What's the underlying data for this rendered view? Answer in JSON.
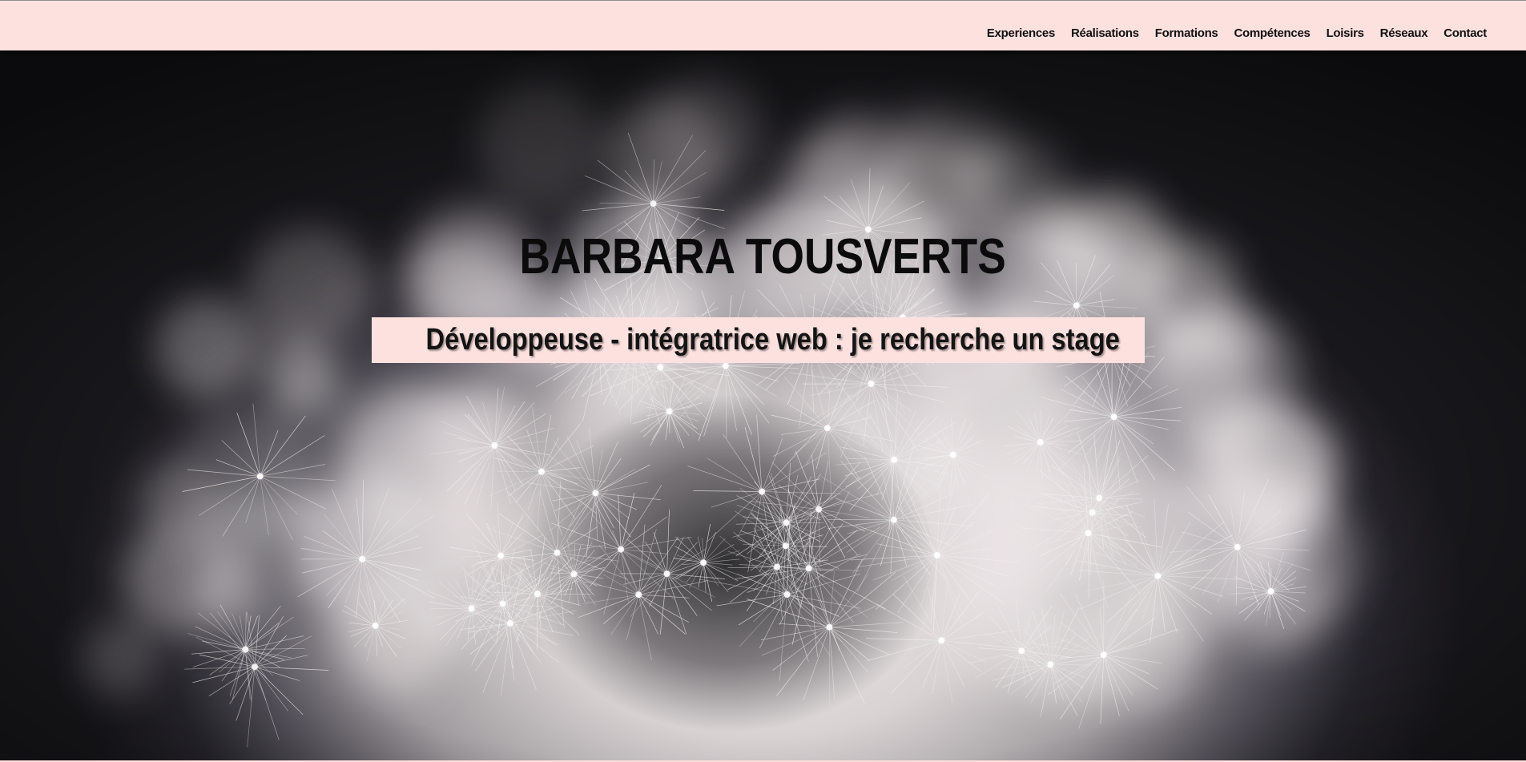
{
  "nav": {
    "items": [
      {
        "label": "Experiences"
      },
      {
        "label": "Réalisations"
      },
      {
        "label": "Formations"
      },
      {
        "label": "Compétences"
      },
      {
        "label": "Loisirs"
      },
      {
        "label": "Réseaux"
      },
      {
        "label": "Contact"
      }
    ]
  },
  "hero": {
    "title": "BARBARA TOUSVERTS",
    "subtitle": "Développeuse - intégratrice web : je recherche un stage",
    "background": "dandelion-photo"
  },
  "colors": {
    "header_bg": "#fde1df",
    "text": "#111111"
  }
}
